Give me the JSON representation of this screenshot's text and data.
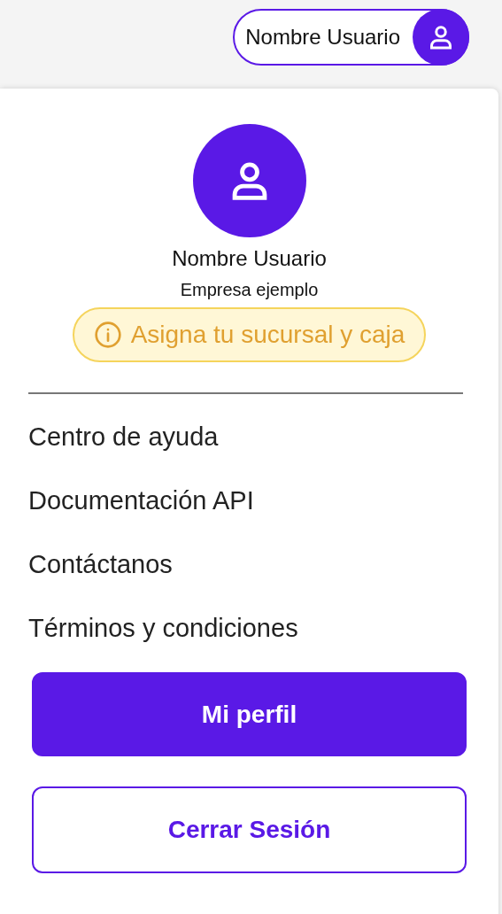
{
  "header": {
    "user_name": "Nombre Usuario"
  },
  "profile": {
    "name": "Nombre Usuario",
    "company": "Empresa ejemplo",
    "notice": "Asigna tu sucursal y caja"
  },
  "menu": [
    {
      "label": "Centro de ayuda"
    },
    {
      "label": "Documentación API"
    },
    {
      "label": "Contáctanos"
    },
    {
      "label": "Términos y condiciones"
    }
  ],
  "buttons": [
    {
      "label": "Mi perfil",
      "kind": "primary"
    },
    {
      "label": "Cerrar Sesión",
      "kind": "outline"
    }
  ]
}
